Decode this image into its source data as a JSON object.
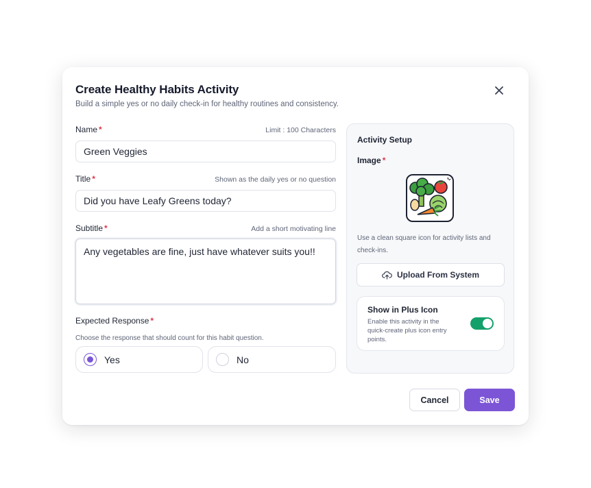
{
  "dialog": {
    "title": "Create Healthy Habits Activity",
    "subtitle": "Build a simple yes or no daily check-in for healthy routines and consistency.",
    "close_icon": "close-icon"
  },
  "form": {
    "name": {
      "label": "Name",
      "required_mark": "*",
      "hint": "Limit : 100 Characters",
      "value": "Green Veggies"
    },
    "title": {
      "label": "Title",
      "required_mark": "*",
      "hint": "Shown as the daily yes or no question",
      "value": "Did you have Leafy Greens today?"
    },
    "subtitle": {
      "label": "Subtitle",
      "required_mark": "*",
      "hint": "Add a short motivating line",
      "value": "Any vegetables are fine, just have whatever suits you!!"
    },
    "expected_response": {
      "label": "Expected Response",
      "required_mark": "*",
      "description": "Choose the response that should count for this habit question.",
      "options": [
        {
          "label": "Yes",
          "selected": true
        },
        {
          "label": "No",
          "selected": false
        }
      ]
    }
  },
  "setup": {
    "title": "Activity Setup",
    "image_label": "Image",
    "required_mark": "*",
    "image_icon": "vegetables-icon",
    "image_hint": "Use a clean square icon for activity lists and check-ins.",
    "upload_label": "Upload From System",
    "upload_icon": "cloud-upload-icon",
    "plus_icon_card": {
      "title": "Show in Plus Icon",
      "description": "Enable this activity in the quick-create plus icon entry points.",
      "enabled": true
    }
  },
  "footer": {
    "cancel_label": "Cancel",
    "save_label": "Save"
  },
  "colors": {
    "accent": "#7c55d6",
    "required": "#e0364a",
    "toggle_on": "#14a06a"
  }
}
